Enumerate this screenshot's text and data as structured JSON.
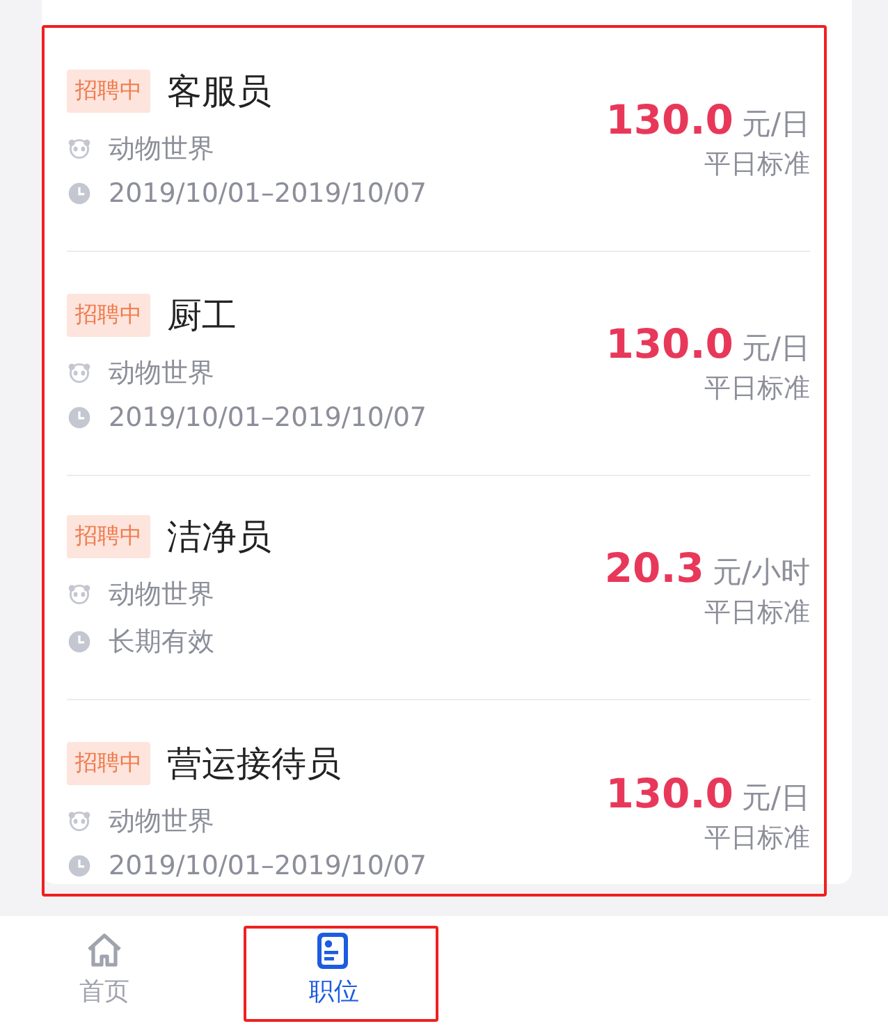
{
  "job_list": {
    "highlighted": true,
    "jobs": [
      {
        "status": "招聘中",
        "title": "客服员",
        "company": "动物世界",
        "period": "2019/10/01–2019/10/07",
        "price": "130.0",
        "unit": "元/日",
        "price_note": "平日标准"
      },
      {
        "status": "招聘中",
        "title": "厨工",
        "company": "动物世界",
        "period": "2019/10/01–2019/10/07",
        "price": "130.0",
        "unit": "元/日",
        "price_note": "平日标准"
      },
      {
        "status": "招聘中",
        "title": "洁净员",
        "company": "动物世界",
        "period": "长期有效",
        "price": "20.3",
        "unit": "元/小时",
        "price_note": "平日标准"
      },
      {
        "status": "招聘中",
        "title": "营运接待员",
        "company": "动物世界",
        "period": "2019/10/01–2019/10/07",
        "price": "130.0",
        "unit": "元/日",
        "price_note": "平日标准"
      }
    ]
  },
  "tab_bar": {
    "tabs": [
      {
        "kind": "home",
        "label": "首页",
        "selected": false,
        "highlighted": false
      },
      {
        "kind": "jobs",
        "label": "职位",
        "selected": true,
        "highlighted": true
      }
    ]
  }
}
